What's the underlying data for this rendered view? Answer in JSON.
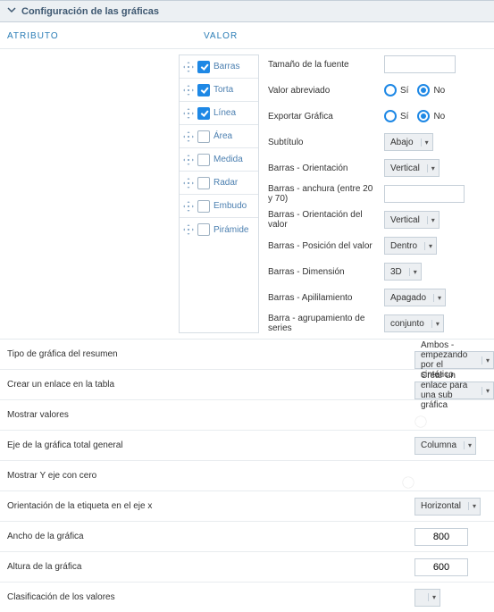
{
  "panel": {
    "title": "Configuración de las gráficas"
  },
  "headers": {
    "attr": "ATRIBUTO",
    "val": "VALOR"
  },
  "chartTypes": [
    {
      "label": "Barras",
      "checked": true
    },
    {
      "label": "Torta",
      "checked": true
    },
    {
      "label": "Línea",
      "checked": true
    },
    {
      "label": "Área",
      "checked": false
    },
    {
      "label": "Medida",
      "checked": false
    },
    {
      "label": "Radar",
      "checked": false
    },
    {
      "label": "Embudo",
      "checked": false
    },
    {
      "label": "Pirámide",
      "checked": false
    }
  ],
  "chartProps": {
    "fontSize": {
      "label": "Tamaño de la fuente",
      "value": ""
    },
    "valAbrev": {
      "label": "Valor abreviado",
      "yes": "Sí",
      "no": "No",
      "selected": "no"
    },
    "exportChart": {
      "label": "Exportar Gráfica",
      "yes": "Sí",
      "no": "No",
      "selected": "no"
    },
    "subtitle": {
      "label": "Subtítulo",
      "value": "Abajo"
    },
    "barsOrient": {
      "label": "Barras - Orientación",
      "value": "Vertical"
    },
    "barsWidth": {
      "label": "Barras - anchura (entre 20 y 70)",
      "value": ""
    },
    "barsValOrient": {
      "label": "Barras - Orientación del valor",
      "value": "Vertical"
    },
    "barsValPos": {
      "label": "Barras - Posición del valor",
      "value": "Dentro"
    },
    "barsDim": {
      "label": "Barras - Dimensión",
      "value": "3D"
    },
    "barsStack": {
      "label": "Barras - Apililamiento",
      "value": "Apagado"
    },
    "barsSeries": {
      "label": "Barra - agrupamiento de series",
      "value": "conjunto"
    }
  },
  "formRows": [
    {
      "label": "Tipo de gráfica del resumen",
      "type": "select",
      "value": "Ambos - empezando por el sintético"
    },
    {
      "label": "Crear un enlace en la tabla",
      "type": "select",
      "value": "Crear un enlace para una sub gráfica"
    },
    {
      "label": "Mostrar valores",
      "type": "toggle",
      "on": false
    },
    {
      "label": "Eje de la gráfica total general",
      "type": "select",
      "value": "Columna"
    },
    {
      "label": "Mostrar Y eje con cero",
      "type": "toggle",
      "on": true
    },
    {
      "label": "Orientación de la etiqueta en el eje x",
      "type": "select",
      "value": "Horizontal"
    },
    {
      "label": "Ancho de la gráfica",
      "type": "num",
      "value": "800"
    },
    {
      "label": "Altura de la gráfica",
      "type": "num",
      "value": "600"
    },
    {
      "label": "Clasificación de los valores",
      "type": "select",
      "value": ""
    }
  ]
}
